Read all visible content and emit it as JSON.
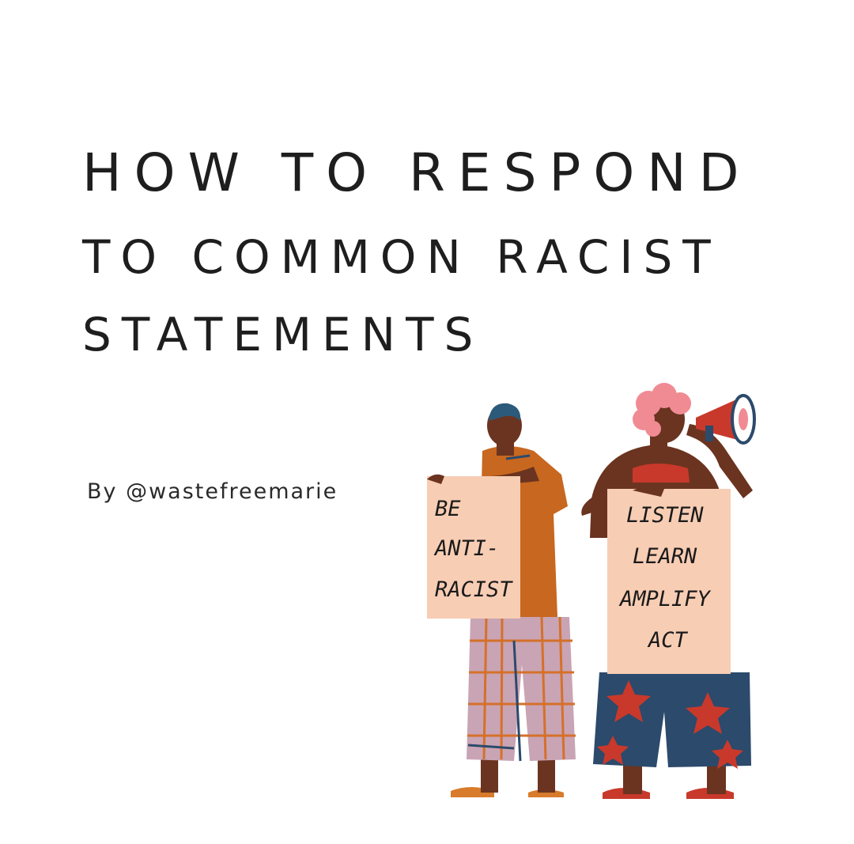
{
  "title": {
    "line1": "HOW TO RESPOND",
    "line2": "TO COMMON RACIST",
    "line3": "STATEMENTS"
  },
  "byline": "By @wastefreemarie",
  "illustration": {
    "left_sign": [
      "BE",
      "ANTI-",
      "RACIST"
    ],
    "right_sign": [
      "LISTEN",
      "LEARN",
      "AMPLIFY",
      "ACT"
    ]
  },
  "colors": {
    "background": "#ffffff",
    "text": "#1e1e1e",
    "skin": "#6b3420",
    "shirt": "#c8671f",
    "sign": "#f7cdb4",
    "hair_left": "#2b5a7a",
    "hair_right": "#f08b94",
    "pants_left": "#c9a4b4",
    "pants_right": "#2c4a6b",
    "star": "#c8392b"
  }
}
